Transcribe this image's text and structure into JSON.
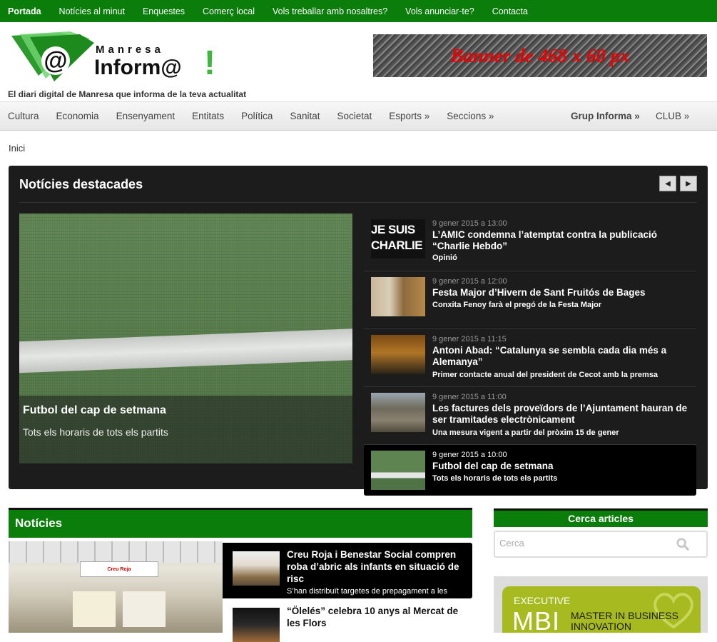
{
  "topnav": [
    "Portada",
    "Notícies al minut",
    "Enquestes",
    "Comerç local",
    "Vols treballar amb nosaltres?",
    "Vols anunciar-te?",
    "Contacta"
  ],
  "logo": {
    "line1": "Manresa",
    "line2": "Inform@",
    "mark": "!",
    "at": "@"
  },
  "tagline": "El diari digital de Manresa que informa de la teva actualitat",
  "banner": "Banner de 468 x 60 px",
  "catnav": {
    "left": [
      "Cultura",
      "Economia",
      "Ensenyament",
      "Entitats",
      "Política",
      "Sanitat",
      "Societat",
      "Esports »",
      "Seccions »"
    ],
    "grup": "Grup Informa »",
    "club": "CLUB »"
  },
  "breadcrumb": "Inici",
  "featured": {
    "heading": "Notícies destacades",
    "prev": "◀",
    "next": "▶",
    "main": {
      "title": "Futbol del cap de setmana",
      "subtitle": "Tots els horaris de tots els partits"
    },
    "items": [
      {
        "date": "9 gener 2015 a 13:00",
        "title": "L’AMIC condemna l’atemptat contra la publicació “Charlie Hebdo”",
        "sub": "Opinió",
        "thumb_text": "JE SUIS CHARLIE"
      },
      {
        "date": "9 gener 2015 a 12:00",
        "title": "Festa Major d’Hivern de Sant Fruitós de Bages",
        "sub": "Conxita Fenoy farà el pregó de la Festa Major"
      },
      {
        "date": "9 gener 2015 a 11:15",
        "title": "Antoni Abad: “Catalunya se sembla cada dia més a Alemanya”",
        "sub": "Primer contacte anual del president de Cecot amb la premsa"
      },
      {
        "date": "9 gener 2015 a 11:00",
        "title": "Les factures dels proveïdors de l’Ajuntament hauran de ser tramitades electrònicament",
        "sub": "Una mesura vigent a partir del pròxim 15 de gener"
      },
      {
        "date": "9 gener 2015 a 10:00",
        "title": "Futbol del cap de setmana",
        "sub": "Tots els horaris de tots els partits"
      }
    ]
  },
  "noticies": {
    "heading": "Notícies",
    "image_sign": "Creu Roja",
    "items": [
      {
        "title": "Creu Roja i Benestar Social compren roba d’abric als infants en situació de risc",
        "sub": "S’han distribuït targetes de prepagament a les"
      },
      {
        "title": "“Ölelés” celebra 10 anys al Mercat de les Flors",
        "sub": ""
      }
    ]
  },
  "sidebar": {
    "cerca_heading": "Cerca articles",
    "cerca_placeholder": "Cerca",
    "ad": {
      "exec": "EXECUTIVE",
      "big": "MBI",
      "master1": "MASTER IN BUSINESS",
      "master2": "INNOVATION"
    }
  },
  "colors": {
    "green": "#0a7d0a",
    "dark": "#1c1c1c"
  }
}
